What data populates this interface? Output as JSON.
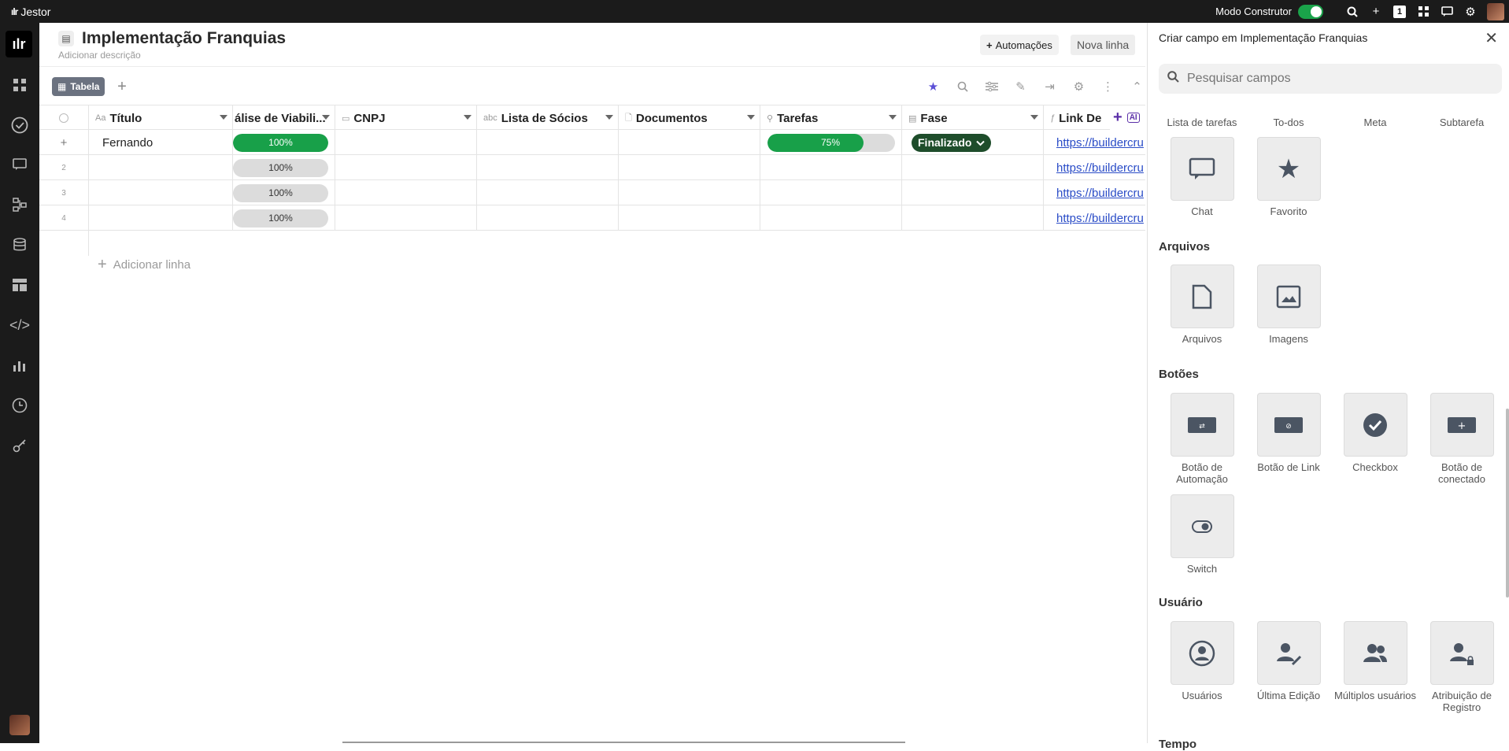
{
  "topbar": {
    "brand": "Jestor",
    "modo_label": "Modo Construtor",
    "badge": "1"
  },
  "header": {
    "title": "Implementação Franquias",
    "description": "Adicionar descrição",
    "automations_label": "Automações",
    "new_row_label": "Nova linha"
  },
  "views": {
    "active_tab": "Tabela"
  },
  "table": {
    "columns": [
      {
        "label": "Título",
        "icon": "Aa"
      },
      {
        "label": "álise de Viabili...",
        "icon": ""
      },
      {
        "label": "CNPJ",
        "icon": "▭"
      },
      {
        "label": "Lista de Sócios",
        "icon": "abc"
      },
      {
        "label": "Documentos",
        "icon": "🗋"
      },
      {
        "label": "Tarefas",
        "icon": "⚲"
      },
      {
        "label": "Fase",
        "icon": "▤"
      },
      {
        "label": "Link De",
        "icon": "ƒ"
      }
    ],
    "rows": [
      {
        "num": "+",
        "titulo": "Fernando",
        "viab": "100%",
        "viab_pct": 100,
        "tarefas": "75%",
        "tarefas_pct": 75,
        "fase": "Finalizado",
        "link": "https://buildercru"
      },
      {
        "num": "2",
        "titulo": "",
        "viab": "100%",
        "viab_pct": 0,
        "tarefas": "",
        "fase": "",
        "link": "https://buildercru"
      },
      {
        "num": "3",
        "titulo": "",
        "viab": "100%",
        "viab_pct": 0,
        "tarefas": "",
        "fase": "",
        "link": "https://buildercru"
      },
      {
        "num": "4",
        "titulo": "",
        "viab": "100%",
        "viab_pct": 0,
        "tarefas": "",
        "fase": "",
        "link": "https://buildercru"
      }
    ],
    "add_row_label": "Adicionar linha"
  },
  "panel": {
    "title": "Criar campo em Implementação Franquias",
    "search_placeholder": "Pesquisar campos",
    "top_labels": [
      "Lista de tarefas",
      "To-dos",
      "Meta",
      "Subtarefa"
    ],
    "tiles_misc": [
      {
        "label": "Chat",
        "icon": "chat-icon"
      },
      {
        "label": "Favorito",
        "icon": "star-icon"
      }
    ],
    "sections": {
      "arquivos": "Arquivos",
      "botoes": "Botões",
      "usuario": "Usuário",
      "tempo": "Tempo"
    },
    "tiles_arquivos": [
      {
        "label": "Arquivos",
        "icon": "file-icon"
      },
      {
        "label": "Imagens",
        "icon": "image-icon"
      }
    ],
    "tiles_botoes": [
      {
        "label": "Botão de Automação",
        "icon": "automation-button-icon"
      },
      {
        "label": "Botão de Link",
        "icon": "link-button-icon"
      },
      {
        "label": "Checkbox",
        "icon": "checkbox-icon"
      },
      {
        "label": "Botão de conectado",
        "icon": "connected-button-icon"
      },
      {
        "label": "Switch",
        "icon": "switch-icon"
      }
    ],
    "tiles_usuario": [
      {
        "label": "Usuários",
        "icon": "user-circle-icon"
      },
      {
        "label": "Última Edição",
        "icon": "user-edit-icon"
      },
      {
        "label": "Múltiplos usuários",
        "icon": "users-icon"
      },
      {
        "label": "Atribuição de Registro",
        "icon": "user-lock-icon"
      }
    ]
  }
}
